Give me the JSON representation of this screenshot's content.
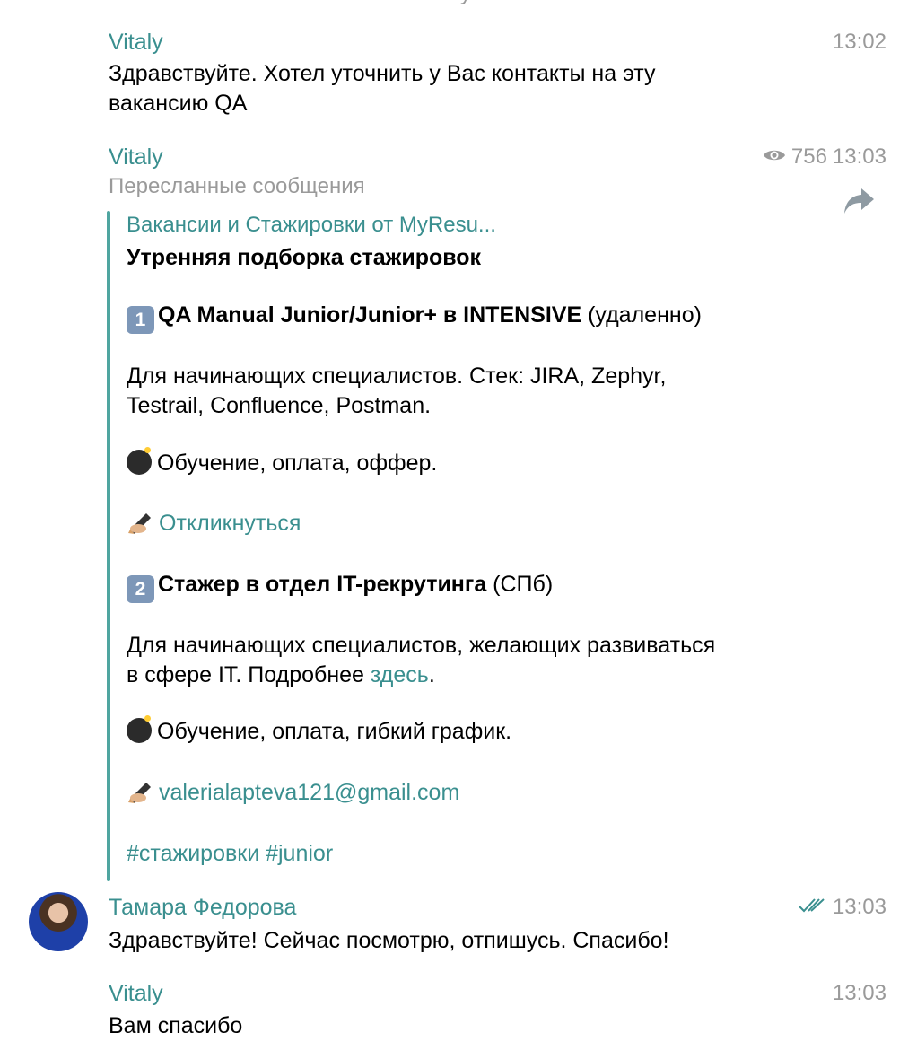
{
  "top_clip": "у",
  "messages": [
    {
      "sender": "Vitaly",
      "time": "13:02",
      "lines": [
        "Здравствуйте. Хотел уточнить у Вас контакты на эту",
        "вакансию QA"
      ]
    },
    {
      "sender": "Vitaly",
      "views": "756",
      "time": "13:03",
      "forwarded_label": "Пересланные сообщения",
      "forward": {
        "source": "Вакансии и Стажировки от MyResu...",
        "title": "Утренняя подборка стажировок",
        "item1": {
          "num": "1",
          "title": "QA Manual Junior/Junior+ в INTENSIVE",
          "suffix": " (удаленно)",
          "desc_line1": "Для начинающих специалистов. Стек: JIRA, Zephyr,",
          "desc_line2": "Testrail, Confluence, Postman.",
          "perks": "Обучение, оплата, оффер.",
          "action": "Откликнуться"
        },
        "item2": {
          "num": "2",
          "title": "Стажер в отдел IT-рекрутинга",
          "suffix": " (СПб)",
          "desc_line1": "Для начинающих специалистов, желающих развиваться",
          "desc_line2_prefix": "в сфере IT. Подробнее ",
          "desc_link": "здесь",
          "desc_line2_suffix": ".",
          "perks": "Обучение, оплата, гибкий график.",
          "contact": "valerialapteva121@gmail.com"
        },
        "tags": "#стажировки #junior"
      }
    },
    {
      "sender": "Тамара Федорова",
      "time": "13:03",
      "text": "Здравствуйте! Сейчас посмотрю, отпишусь. Спасибо!"
    },
    {
      "sender": "Vitaly",
      "time": "13:03",
      "text": "Вам спасибо"
    }
  ],
  "colors": {
    "accent": "#3a8f8f",
    "bar": "#4fa5a0",
    "muted": "#9a9a9a"
  }
}
